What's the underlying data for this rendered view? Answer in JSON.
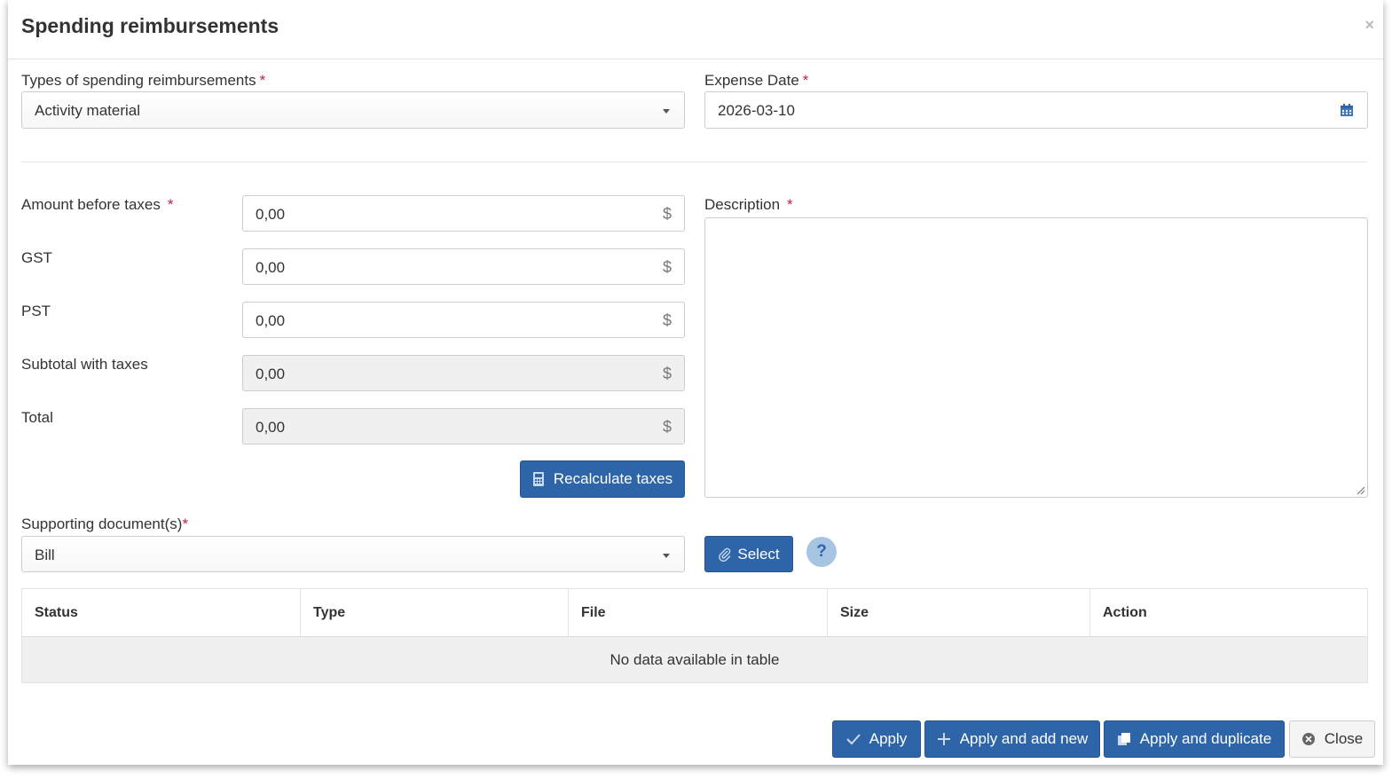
{
  "modal": {
    "title": "Spending reimbursements",
    "close_glyph": "×"
  },
  "form": {
    "type_label": "Types of spending reimbursements",
    "type_value": "Activity material",
    "date_label": "Expense Date",
    "date_value": "2026-03-10",
    "required_mark": "*",
    "amount_label": "Amount before taxes",
    "amount_value": "0,00",
    "gst_label": "GST",
    "gst_value": "0,00",
    "pst_label": "PST",
    "pst_value": "0,00",
    "subtotal_label": "Subtotal with taxes",
    "subtotal_value": "0,00",
    "total_label": "Total",
    "total_value": "0,00",
    "currency": "$",
    "recalc_label": "Recalculate taxes",
    "description_label": "Description",
    "description_value": "",
    "docs_label": "Supporting document(s)",
    "docs_value": "Bill",
    "select_label": "Select",
    "help_glyph": "?"
  },
  "table": {
    "columns": [
      "Status",
      "Type",
      "File",
      "Size",
      "Action"
    ],
    "empty_text": "No data available in table"
  },
  "footer": {
    "apply": "Apply",
    "apply_new": "Apply and add new",
    "apply_duplicate": "Apply and duplicate",
    "close": "Close"
  },
  "icons": {
    "calendar": "calendar-icon",
    "calculator": "calculator-icon",
    "paperclip": "paperclip-icon",
    "check": "check-icon",
    "plus": "plus-icon",
    "copy": "copy-icon",
    "close_circle": "close-circle-icon"
  },
  "colors": {
    "primary": "#2e65a8",
    "required": "#c2185b",
    "help_bg": "#a7c4e3"
  }
}
